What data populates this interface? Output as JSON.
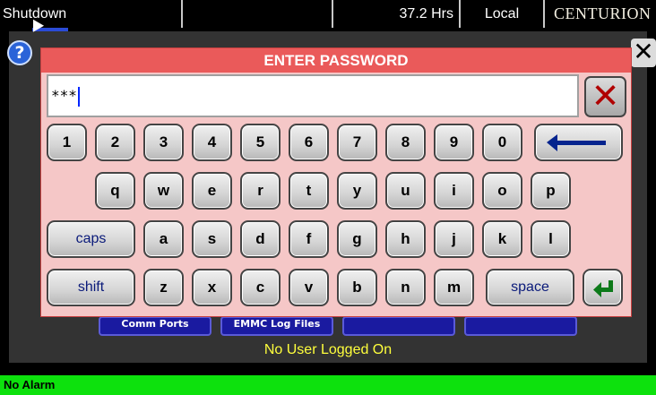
{
  "topbar": {
    "state": "Shutdown",
    "empty": "",
    "hours": "37.2 Hrs",
    "mode": "Local",
    "brand": "CENTURION"
  },
  "main": {
    "status_text": "No User Logged On",
    "buttons": [
      "Comm Ports",
      "EMMC Log Files",
      "",
      ""
    ]
  },
  "help_label": "?",
  "close_label": "✕",
  "dialog": {
    "title": "ENTER PASSWORD",
    "password_value": "***",
    "clear_label": "✕",
    "row1": [
      "1",
      "2",
      "3",
      "4",
      "5",
      "6",
      "7",
      "8",
      "9",
      "0"
    ],
    "row2": [
      "q",
      "w",
      "e",
      "r",
      "t",
      "y",
      "u",
      "i",
      "o",
      "p"
    ],
    "row3": [
      "a",
      "s",
      "d",
      "f",
      "g",
      "h",
      "j",
      "k",
      "l"
    ],
    "row4": [
      "z",
      "x",
      "c",
      "v",
      "b",
      "n",
      "m"
    ],
    "caps_label": "caps",
    "shift_label": "shift",
    "space_label": "space",
    "backspace_icon": "left-arrow",
    "enter_icon": "enter-arrow"
  },
  "alarm_bar": {
    "text": "No Alarm",
    "color": "#0de10d"
  },
  "colors": {
    "dialog_title_bg": "#ea5a5a",
    "dialog_bg": "#f5c7c7",
    "status_text": "#ffff3c"
  }
}
